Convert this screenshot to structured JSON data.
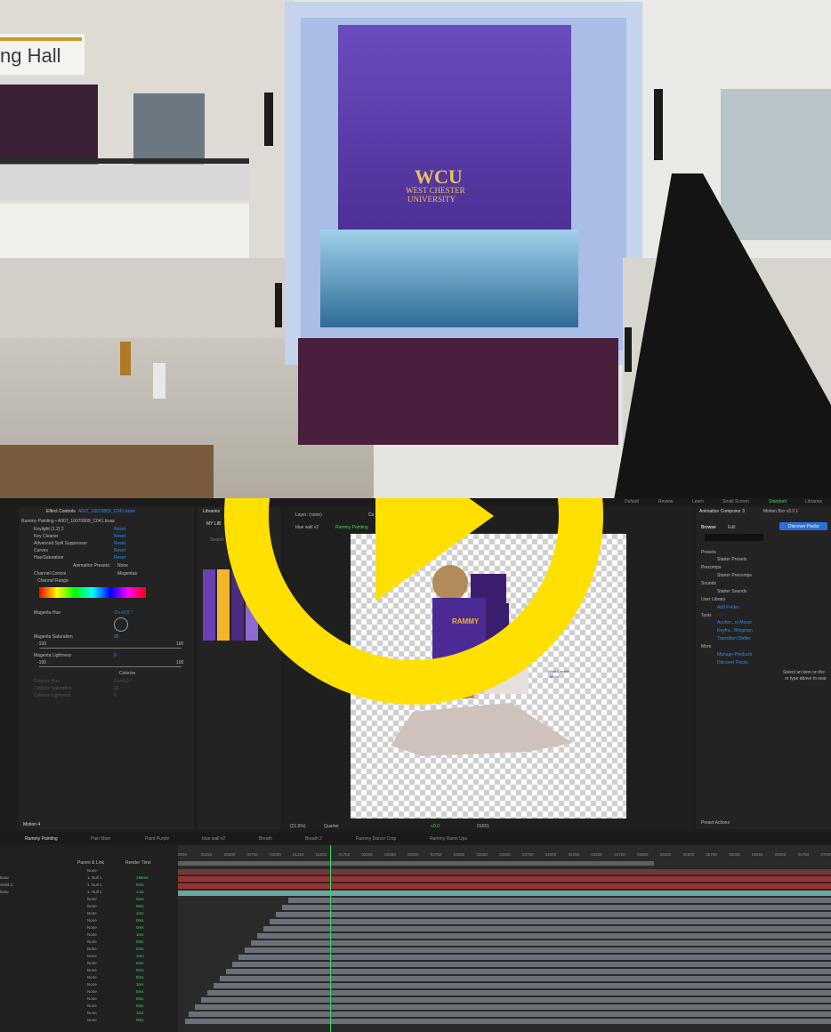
{
  "photo": {
    "building_sign": "ng Hall",
    "logo_main": "WCU",
    "logo_sub_1": "WEST CHESTER",
    "logo_sub_2": "UNIVERSITY"
  },
  "workspace": [
    "Default",
    "Review",
    "Learn",
    "Small Screen",
    "Standard",
    "Libraries"
  ],
  "effect_controls": {
    "title": "Effect Controls",
    "layer": "A007_10070809_C041.braw",
    "path": "Rammy Painting • A007_10070809_C041.braw",
    "effects": [
      {
        "name": "Keylight (1.2) 2",
        "reset": "Reset"
      },
      {
        "name": "Key Cleaner",
        "reset": "Reset"
      },
      {
        "name": "Advanced Spill Suppressor",
        "reset": "Reset"
      },
      {
        "name": "Curves",
        "reset": "Reset"
      },
      {
        "name": "Hue/Saturation",
        "reset": "Reset"
      }
    ],
    "animation_presets_label": "Animation Presets:",
    "animation_presets_value": "None",
    "channel_control_label": "Channel Control",
    "channel_control_value": "Magentas",
    "channel_range_label": "Channel Range",
    "magenta_hue_label": "Magenta Hue",
    "magenta_hue_value": "0 x+0.0 °",
    "magenta_sat_label": "Magenta Saturation",
    "magenta_sat_value": "25",
    "sat_min": "-100",
    "sat_max": "100",
    "magenta_light_label": "Magenta Lightness",
    "magenta_light_value": "9",
    "light_min": "-100",
    "light_max": "100",
    "colorize": "Colorize",
    "colorize_hue": "Colorize Hue",
    "colorize_hue_value": "0 x+0.0 °",
    "colorize_sat": "Colorize Saturation",
    "colorize_sat_value": "25",
    "colorize_light": "Colorize Lightness",
    "colorize_light_value": "0",
    "footer": "Motion 4"
  },
  "libraries": {
    "title": "Libraries",
    "my_lib": "MY LIB",
    "search": "Search"
  },
  "composition": {
    "layer_label": "Layer: (none)",
    "tab_prefix": "Co",
    "breadcrumb_1": "blue wall v2",
    "breadcrumb_2": "Rammy Painting",
    "zoom": "(21.6%)",
    "resolution": "Quarter",
    "exposure": "+0.0",
    "timecode": "01651",
    "shirt_text": "RAMMY",
    "sign_text_1": "West Chester",
    "sign_text_2": "Moon"
  },
  "animation_composer": {
    "title": "Animation Composer 3",
    "tab2": "Motion Bro v3.2.1",
    "browse": "Browse",
    "edit": "Edit",
    "discover_button": "Discover Packs",
    "presets_h": "Presets",
    "starter_presets": "Starter Presets",
    "precomps_h": "Precomps",
    "starter_precomps": "Starter Precomps",
    "sounds_h": "Sounds",
    "starter_sounds": "Starter Sounds",
    "user_lib_h": "User Library",
    "add_folder": "Add Folder",
    "tools_h": "Tools",
    "tool_1": "Anchor...nt Mover",
    "tool_2": "Keyfra...Wingman",
    "tool_3": "Transition Shifter",
    "more_h": "More",
    "manage": "Manage Products",
    "discover": "Discover Packs",
    "empty_1": "Select an item on the",
    "empty_2": "or type above to sear",
    "preset_actions": "Preset Actions"
  },
  "timeline": {
    "tabs": [
      "Rammy Painting",
      "Pain Main",
      "Paint Purple",
      "blue wall v2",
      "Breath",
      "Breath 2",
      "Rammy Dance Crop",
      "Rammy Rams Ups"
    ],
    "ruler": [
      "0000",
      "00250",
      "00500",
      "00750",
      "01000",
      "01250",
      "01500",
      "01750",
      "02000",
      "02250",
      "02500",
      "02750",
      "03000",
      "03250",
      "03500",
      "03750",
      "04000",
      "04250",
      "04500",
      "04750",
      "05000",
      "05250",
      "05500",
      "05750",
      "06000",
      "06250",
      "06500",
      "06750",
      "07000"
    ],
    "col_parent": "Parent & Link",
    "col_render": "Render Time",
    "rows": [
      {
        "name": "",
        "parent": "None",
        "render": ""
      },
      {
        "name": "braw",
        "parent": "1. Null 1",
        "render": "196ms"
      },
      {
        "name": "Solid 3",
        "parent": "1. Null 1",
        "render": "0ms"
      },
      {
        "name": "braw",
        "parent": "1. Null 1",
        "render": "1.5s"
      },
      {
        "name": "",
        "parent": "None",
        "render": "0ms"
      },
      {
        "name": "",
        "parent": "None",
        "render": "0ms"
      },
      {
        "name": "",
        "parent": "None",
        "render": "1ms"
      },
      {
        "name": "",
        "parent": "None",
        "render": "0ms"
      },
      {
        "name": "",
        "parent": "None",
        "render": "0ms"
      },
      {
        "name": "",
        "parent": "None",
        "render": "1ms"
      },
      {
        "name": "",
        "parent": "None",
        "render": "0ms"
      },
      {
        "name": "",
        "parent": "None",
        "render": "0ms"
      },
      {
        "name": "",
        "parent": "None",
        "render": "1ms"
      },
      {
        "name": "",
        "parent": "None",
        "render": "0ms"
      },
      {
        "name": "",
        "parent": "None",
        "render": "0ms"
      },
      {
        "name": "",
        "parent": "None",
        "render": "0ms"
      },
      {
        "name": "",
        "parent": "None",
        "render": "1ms"
      },
      {
        "name": "",
        "parent": "None",
        "render": "0ms"
      },
      {
        "name": "",
        "parent": "None",
        "render": "0ms"
      },
      {
        "name": "",
        "parent": "None",
        "render": "0ms"
      },
      {
        "name": "",
        "parent": "None",
        "render": "1ms"
      },
      {
        "name": "",
        "parent": "None",
        "render": "0ms"
      }
    ]
  },
  "colors": {
    "accent_green": "#3cd66a",
    "play_yellow": "#ffe000",
    "wall_purple": "#5a3aa8"
  }
}
